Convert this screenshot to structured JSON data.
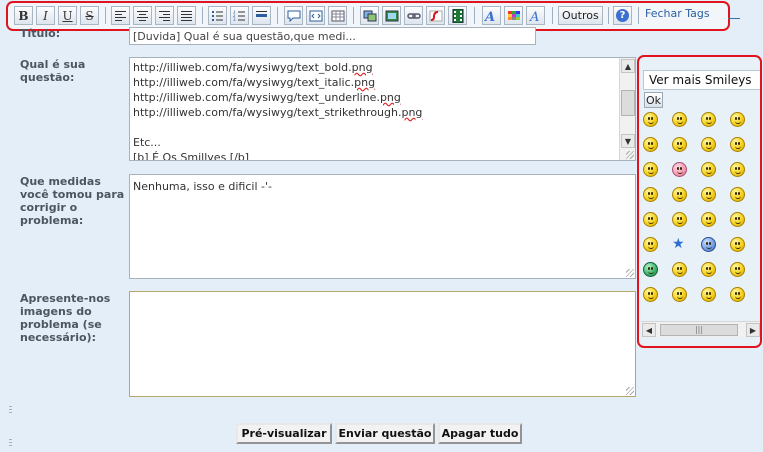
{
  "toolbar": {
    "bold_label": "B",
    "italic_label": "I",
    "underline_label": "U",
    "strike_label": "S",
    "others_label": "Outros",
    "close_tags_label": "Fechar Tags",
    "help_glyph": "?",
    "icons": [
      "align-left-icon",
      "align-center-icon",
      "align-right-icon",
      "align-justify-icon",
      "unordered-list-icon",
      "ordered-list-icon",
      "horizontal-rule-icon",
      "quote-icon",
      "code-icon",
      "table-icon",
      "image-host-icon",
      "image-icon",
      "link-icon",
      "flash-icon",
      "video-icon",
      "font-face-icon",
      "color-icon",
      "font-size-icon",
      "help-icon"
    ]
  },
  "form": {
    "title_label": "Título:",
    "title_value": "[Duvida] Qual é sua questão,que medi...",
    "question_label": "Qual é sua questão:",
    "question_lines": [
      "http://illiweb.com/fa/wysiwyg/text_bold.png",
      "http://illiweb.com/fa/wysiwyg/text_italic.png",
      "http://illiweb.com/fa/wysiwyg/text_underline.png",
      "http://illiweb.com/fa/wysiwyg/text_strikethrough.png",
      "",
      "Etc...",
      "[b] É Os Smillyes [/b]"
    ],
    "measures_label": "Que medidas você tomou para corrigir o problema:",
    "measures_value": "Nenhuma, isso e dificil -'-",
    "images_label": "Apresente-nos imagens do problema (se necessário):",
    "images_value": ""
  },
  "smileys": {
    "title": "Ver mais Smileys",
    "ok_label": "Ok",
    "items": [
      "grin",
      "grin",
      "worried",
      "smile",
      "cool",
      "cool",
      "happy",
      "neutral",
      "tongue",
      "pig",
      "sad",
      "angry",
      "evil",
      "sunglasses",
      "smile",
      "exclaim",
      "question",
      "idea",
      "plain",
      "confused",
      "eyes",
      "star",
      "blue-face",
      "heart",
      "alien",
      "rolleyes",
      "smile",
      "clown",
      "laugh",
      "grin",
      "surprised",
      "sad"
    ]
  },
  "buttons": {
    "preview": "Pré-visualizar",
    "submit": "Enviar questão",
    "clear": "Apagar tudo"
  },
  "colors": {
    "highlight_border": "#e0141e",
    "page_background": "#e3eef8",
    "label_color": "#4a5660",
    "link_color": "#2b5fa0"
  }
}
